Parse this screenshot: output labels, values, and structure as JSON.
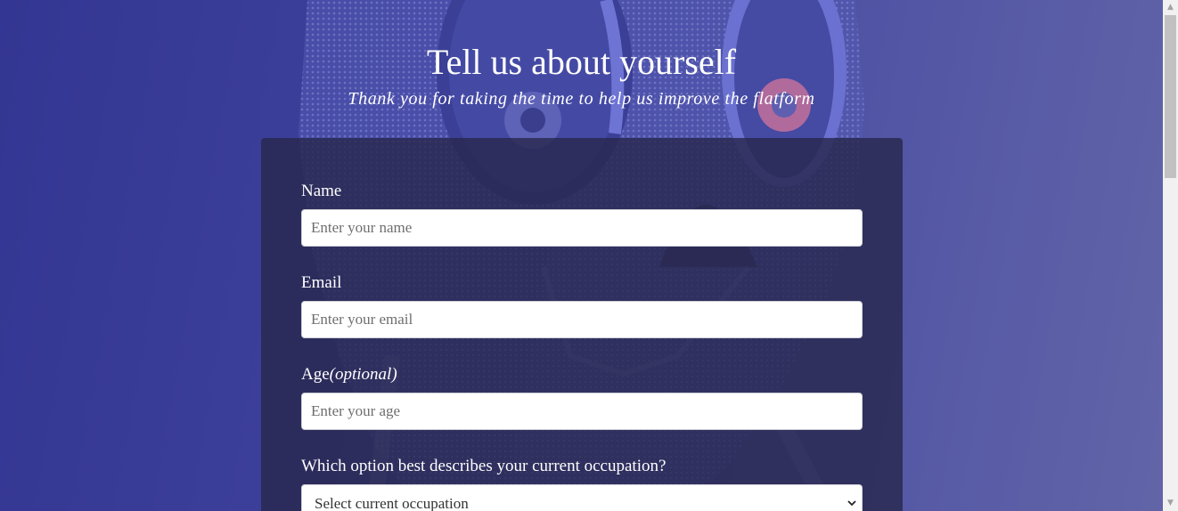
{
  "header": {
    "title": "Tell us about yourself",
    "subtitle": "Thank you for taking the time to help us improve the flatform"
  },
  "form": {
    "name": {
      "label": "Name",
      "placeholder": "Enter your name"
    },
    "email": {
      "label": "Email",
      "placeholder": "Enter your email"
    },
    "age": {
      "label": "Age",
      "optional_note": "(optional)",
      "placeholder": "Enter your age"
    },
    "occupation": {
      "label": "Which option best describes your current occupation?",
      "selected": "Select current occupation"
    }
  },
  "scrollbar": {
    "up_arrow": "▲",
    "down_arrow": "▼"
  },
  "icons": {
    "select_chevron": "chevron-down-icon"
  },
  "colors": {
    "background": "#333692",
    "card": "#28284e",
    "text": "#ffffff"
  }
}
